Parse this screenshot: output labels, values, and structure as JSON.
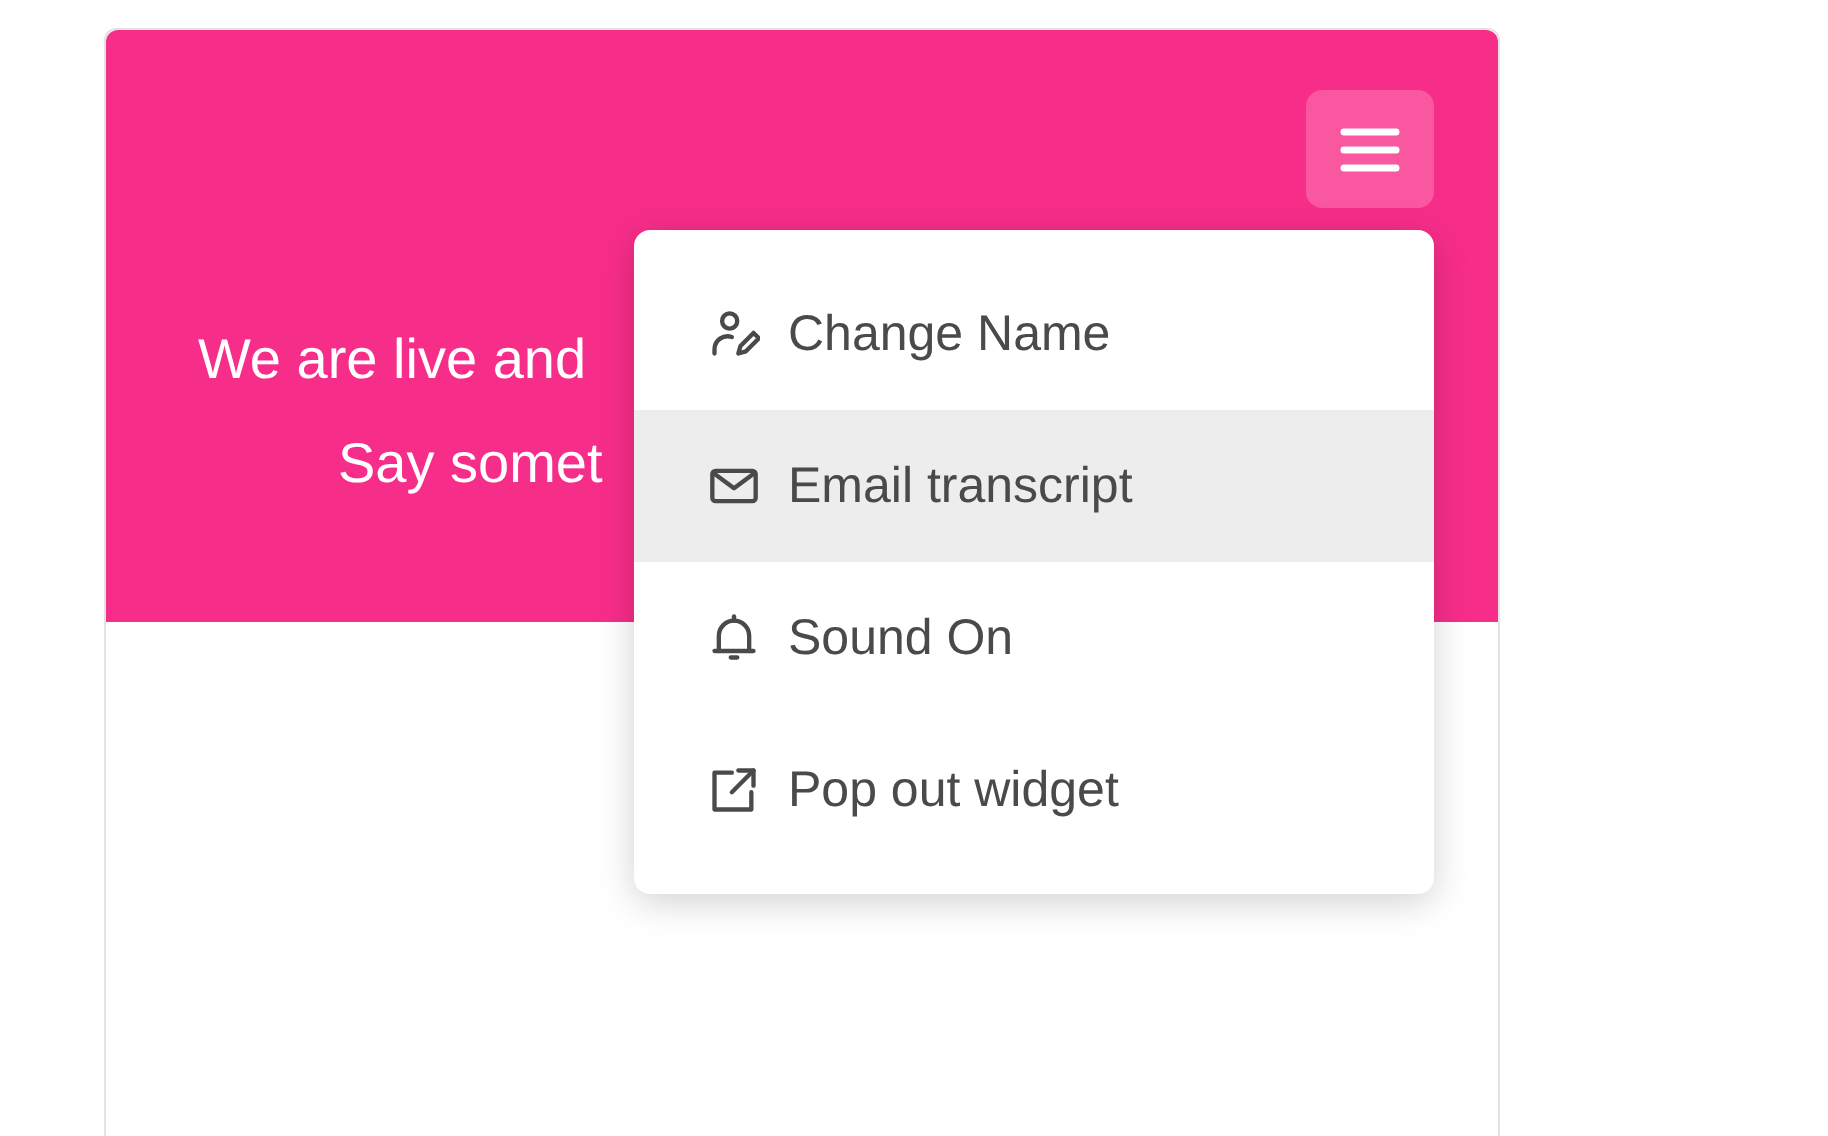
{
  "header": {
    "lines": [
      "We are live and",
      "Say somet"
    ]
  },
  "menu": {
    "items": [
      {
        "label": "Change Name",
        "selected": false
      },
      {
        "label": "Email transcript",
        "selected": true
      },
      {
        "label": "Sound On",
        "selected": false
      },
      {
        "label": "Pop out widget",
        "selected": false
      }
    ]
  }
}
